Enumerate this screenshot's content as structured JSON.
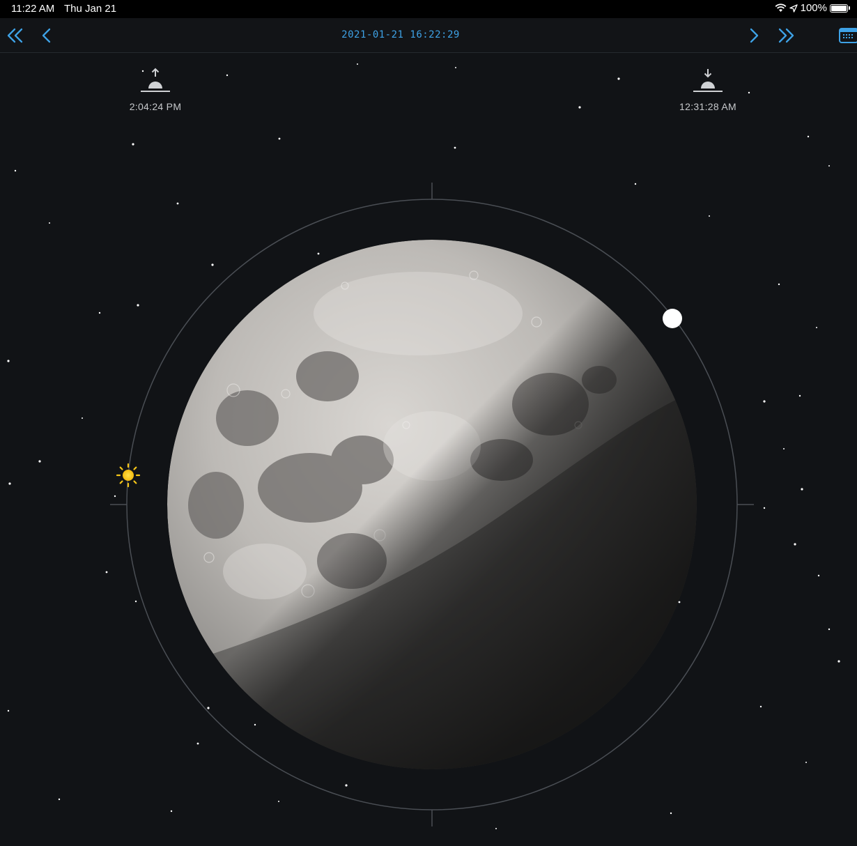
{
  "status_bar": {
    "time": "11:22 AM",
    "date": "Thu Jan 21",
    "battery": "100%"
  },
  "nav": {
    "datetime": "2021-01-21 16:22:29"
  },
  "rise": {
    "time": "2:04:24 PM"
  },
  "set": {
    "time": "12:31:28 AM"
  },
  "colors": {
    "accent": "#3ea2e6",
    "background": "#111316",
    "sun": "#f5c518"
  },
  "icons": {
    "skip_back": "double-chevron-left-icon",
    "back": "chevron-left-icon",
    "forward": "chevron-right-icon",
    "skip_forward": "double-chevron-right-icon",
    "calendar": "calendar-icon",
    "moonrise": "moonrise-icon",
    "moonset": "moonset-icon",
    "sun": "sun-icon",
    "moon_position": "moon-position-dot"
  }
}
